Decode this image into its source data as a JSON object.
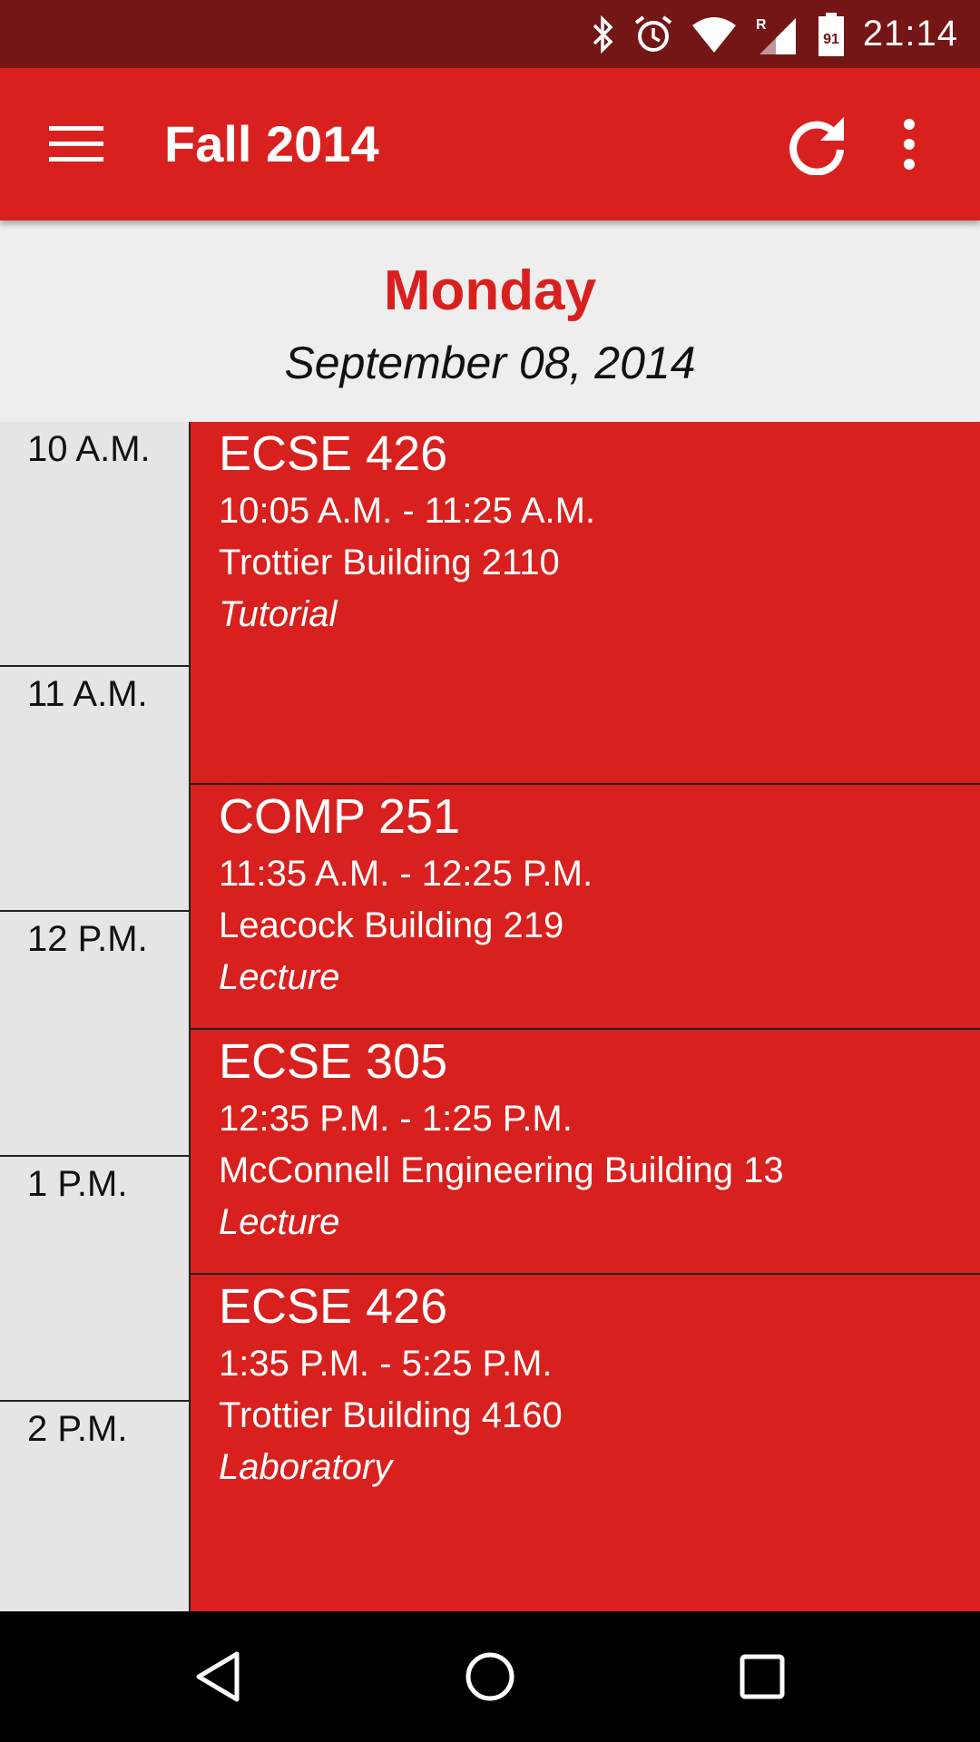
{
  "status_bar": {
    "time": "21:14",
    "battery_level": "91",
    "icons": [
      "bluetooth-icon",
      "alarm-icon",
      "wifi-icon",
      "signal-roaming-icon",
      "battery-icon"
    ]
  },
  "app_bar": {
    "title": "Fall 2014",
    "icons": [
      "menu-icon",
      "refresh-icon",
      "more-vert-icon"
    ]
  },
  "day": {
    "name": "Monday",
    "date": "September 08, 2014"
  },
  "time_slots": [
    "10 A.M.",
    "11 A.M.",
    "12 P.M.",
    "1 P.M.",
    "2 P.M."
  ],
  "events": [
    {
      "code": "ECSE 426",
      "time": "10:05 A.M. - 11:25 A.M.",
      "location": "Trottier Building 2110",
      "type": "Tutorial"
    },
    {
      "code": "COMP 251",
      "time": "11:35 A.M. - 12:25 P.M.",
      "location": "Leacock Building 219",
      "type": "Lecture"
    },
    {
      "code": "ECSE 305",
      "time": "12:35 P.M. - 1:25 P.M.",
      "location": "McConnell Engineering Building 13",
      "type": "Lecture"
    },
    {
      "code": "ECSE 426",
      "time": "1:35 P.M. - 5:25 P.M.",
      "location": "Trottier Building 4160",
      "type": "Laboratory"
    }
  ],
  "colors": {
    "status_bar": "#731615",
    "primary": "#d8211e",
    "background": "#eeeeee",
    "time_column": "#e5e5e5",
    "nav_bar": "#000000"
  },
  "nav_bar": {
    "icons": [
      "back-icon",
      "home-icon",
      "recents-icon"
    ]
  }
}
